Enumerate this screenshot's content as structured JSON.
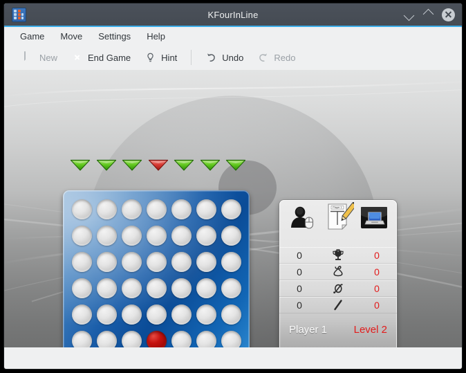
{
  "window": {
    "title": "KFourInLine",
    "app_icon": "kfourinline-icon",
    "accent_color": "#3daee9",
    "titlebar_color": "#474e56",
    "controls": [
      {
        "name": "minimize-button",
        "icon": "chevron-down-icon",
        "label": "Minimize"
      },
      {
        "name": "maximize-button",
        "icon": "chevron-up-icon",
        "label": "Maximize"
      },
      {
        "name": "close-button",
        "icon": "close-icon",
        "label": "Close"
      }
    ]
  },
  "menubar": {
    "items": [
      {
        "label": "Game"
      },
      {
        "label": "Move"
      },
      {
        "label": "Settings"
      },
      {
        "label": "Help"
      }
    ]
  },
  "toolbar": {
    "buttons": [
      {
        "label": "New",
        "icon": "new-document-icon",
        "enabled": false
      },
      {
        "label": "End Game",
        "icon": "end-game-icon",
        "enabled": true
      },
      {
        "label": "Hint",
        "icon": "lightbulb-icon",
        "enabled": true
      },
      {
        "label": "Undo",
        "icon": "undo-arrow-icon",
        "enabled": true
      },
      {
        "label": "Redo",
        "icon": "redo-arrow-icon",
        "enabled": false
      }
    ]
  },
  "board": {
    "columns": 7,
    "rows": 6,
    "column_arrows": [
      {
        "column": 1,
        "color": "green"
      },
      {
        "column": 2,
        "color": "green"
      },
      {
        "column": 3,
        "color": "green"
      },
      {
        "column": 4,
        "color": "red"
      },
      {
        "column": 5,
        "color": "green"
      },
      {
        "column": 6,
        "color": "green"
      },
      {
        "column": 7,
        "color": "green"
      }
    ],
    "arrow_green": "#4fc417",
    "arrow_red": "#d83a33",
    "cells": [
      [
        "empty",
        "empty",
        "empty",
        "empty",
        "empty",
        "empty",
        "empty"
      ],
      [
        "empty",
        "empty",
        "empty",
        "empty",
        "empty",
        "empty",
        "empty"
      ],
      [
        "empty",
        "empty",
        "empty",
        "empty",
        "empty",
        "empty",
        "empty"
      ],
      [
        "empty",
        "empty",
        "empty",
        "empty",
        "empty",
        "empty",
        "empty"
      ],
      [
        "empty",
        "empty",
        "empty",
        "empty",
        "empty",
        "empty",
        "empty"
      ],
      [
        "empty",
        "empty",
        "empty",
        "red",
        "empty",
        "empty",
        "empty"
      ]
    ],
    "piece_red_color": "#c5120f",
    "board_color": "#0e55a5"
  },
  "scorepanel": {
    "avatars": [
      {
        "name": "human-player-icon",
        "label": "Human player"
      },
      {
        "name": "edit-names-icon",
        "label": "Player 1"
      },
      {
        "name": "computer-player-icon",
        "label": "Computer player"
      }
    ],
    "stat_rows": [
      {
        "icon": "trophy-icon",
        "stat": "Wins",
        "left": "0",
        "right": "0"
      },
      {
        "icon": "knot-icon",
        "stat": "Draws",
        "left": "0",
        "right": "0"
      },
      {
        "icon": "zero-slash-icon",
        "stat": "Losses",
        "left": "0",
        "right": "0"
      },
      {
        "icon": "slash-icon",
        "stat": "Breaks",
        "left": "0",
        "right": "0"
      }
    ],
    "current_player": "Player 1",
    "level": "Level 2",
    "player_color": "#fbfbfb",
    "level_color": "#e21b1b"
  }
}
